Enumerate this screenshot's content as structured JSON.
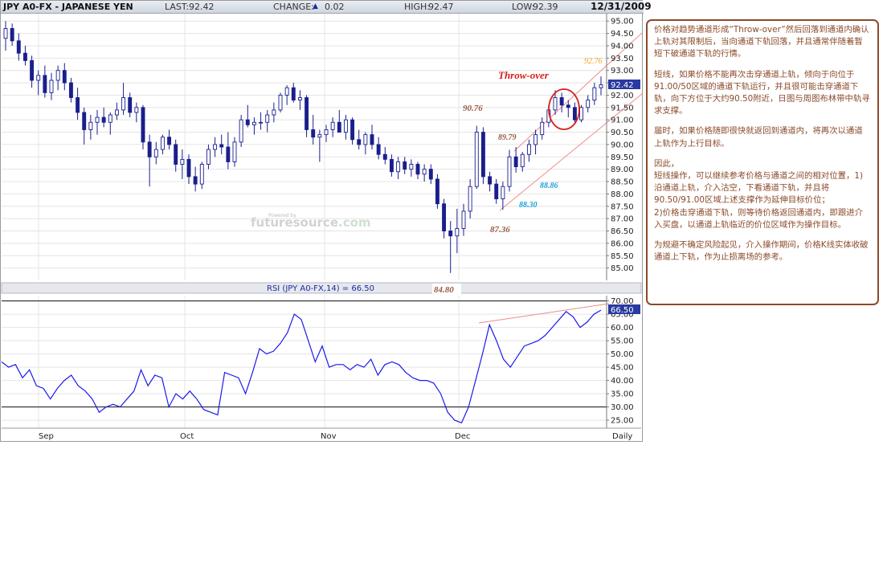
{
  "header": {
    "symbol": "JPY A0-FX - JAPANESE YEN",
    "last_label": "LAST:",
    "last_value": "92.42",
    "change_label": "CHANGE:",
    "change_arrow": "▲",
    "change_value": "0.02",
    "high_label": "HIGH:",
    "high_value": "92.47",
    "low_label": "LOW:",
    "low_value": "92.39",
    "date": "12/31/2009"
  },
  "watermark": {
    "small": "Powered by",
    "brand": "futuresource",
    "suffix": ".com"
  },
  "colors": {
    "up_candle": "#ffffff",
    "down_candle": "#1a1f8c",
    "rsi_line": "#1a1aee",
    "channel": "#f08a8a",
    "annot_brown": "#9a5a42",
    "annot_orange": "#f0a020",
    "annot_cyan": "#1aa0d8",
    "throw_over": "#d81e1e"
  },
  "annotations": {
    "throw_over": "Throw-over",
    "p9276": "92.76",
    "p9076": "90.76",
    "p8979": "89.79",
    "p8886": "88.86",
    "p8830": "88.30",
    "p8736": "87.36",
    "p8480": "84.80"
  },
  "rsi_label": "RSI (JPY A0-FX,14) = 66.50",
  "notes": [
    "价格对趋势通道形成“Throw-over”然后回落到通道内确认上轨对其限制后，当向通道下轨回落，并且通常伴随着暂短下破通道下轨的行情。",
    "短线，如果价格不能再次击穿通道上轨，倾向于向位于91.00/50区域的通道下轨运行，并且很可能击穿通道下轨，向下方位于大约90.50附近，日图与周图布林带中轨寻求支撑。",
    "届时，如果价格随即很快就返回到通道内，将再次以通道上轨作为上行目标。",
    "因此，\n短线操作，可以继续参考价格与通道之间的相对位置，1) 沿通道上轨，介入沽空，下看通道下轨，并且将90.50/91.00区域上述支撑作为延伸目标价位；\n2)价格击穿通道下轨，则等待价格返回通道内，即跟进介入买盘，以通道上轨临近的价位区域作为操作目标。",
    "为规避不确定风险起见，介入操作期间，价格K线实体收破通道上下轨，作为止损离场的参考。"
  ],
  "chart_data": [
    {
      "type": "candlestick",
      "title": "JPY A0-FX - JAPANESE YEN",
      "ylim": [
        84.5,
        95.3
      ],
      "y_ticks": [
        "95.00",
        "94.50",
        "94.00",
        "93.50",
        "93.00",
        "92.50",
        "92.00",
        "91.50",
        "91.00",
        "90.50",
        "90.00",
        "89.50",
        "89.00",
        "88.50",
        "88.00",
        "87.50",
        "87.00",
        "86.50",
        "86.00",
        "85.50",
        "85.00"
      ],
      "x_ticks": [
        "Sep",
        "Oct",
        "Nov",
        "Dec",
        "Daily"
      ],
      "last_price": "92.42",
      "grid": true,
      "candles": [
        {
          "o": 94.3,
          "h": 95.0,
          "l": 93.8,
          "c": 94.7
        },
        {
          "o": 94.7,
          "h": 94.9,
          "l": 94.0,
          "c": 94.2
        },
        {
          "o": 94.2,
          "h": 94.5,
          "l": 93.4,
          "c": 93.7
        },
        {
          "o": 93.7,
          "h": 94.0,
          "l": 93.2,
          "c": 93.4
        },
        {
          "o": 93.4,
          "h": 93.6,
          "l": 92.3,
          "c": 92.6
        },
        {
          "o": 92.6,
          "h": 93.0,
          "l": 92.0,
          "c": 92.8
        },
        {
          "o": 92.8,
          "h": 93.2,
          "l": 91.9,
          "c": 92.1
        },
        {
          "o": 92.1,
          "h": 92.9,
          "l": 91.8,
          "c": 92.6
        },
        {
          "o": 92.6,
          "h": 93.2,
          "l": 92.2,
          "c": 93.0
        },
        {
          "o": 93.0,
          "h": 93.3,
          "l": 92.2,
          "c": 92.5
        },
        {
          "o": 92.5,
          "h": 92.7,
          "l": 91.7,
          "c": 91.9
        },
        {
          "o": 91.9,
          "h": 92.3,
          "l": 91.0,
          "c": 91.3
        },
        {
          "o": 91.3,
          "h": 91.5,
          "l": 90.0,
          "c": 90.6
        },
        {
          "o": 90.6,
          "h": 91.2,
          "l": 90.2,
          "c": 90.9
        },
        {
          "o": 90.9,
          "h": 91.4,
          "l": 90.4,
          "c": 91.1
        },
        {
          "o": 91.1,
          "h": 91.5,
          "l": 90.7,
          "c": 90.9
        },
        {
          "o": 90.9,
          "h": 91.3,
          "l": 90.4,
          "c": 91.2
        },
        {
          "o": 91.2,
          "h": 91.7,
          "l": 91.0,
          "c": 91.4
        },
        {
          "o": 91.4,
          "h": 92.5,
          "l": 91.2,
          "c": 91.9
        },
        {
          "o": 91.9,
          "h": 92.1,
          "l": 91.1,
          "c": 91.3
        },
        {
          "o": 91.3,
          "h": 91.7,
          "l": 90.9,
          "c": 91.5
        },
        {
          "o": 91.5,
          "h": 91.6,
          "l": 89.8,
          "c": 90.1
        },
        {
          "o": 90.1,
          "h": 90.4,
          "l": 88.3,
          "c": 89.5
        },
        {
          "o": 89.5,
          "h": 90.1,
          "l": 89.2,
          "c": 89.8
        },
        {
          "o": 89.8,
          "h": 90.4,
          "l": 89.6,
          "c": 90.3
        },
        {
          "o": 90.3,
          "h": 90.6,
          "l": 89.8,
          "c": 90.0
        },
        {
          "o": 90.0,
          "h": 90.2,
          "l": 88.9,
          "c": 89.2
        },
        {
          "o": 89.2,
          "h": 89.8,
          "l": 88.6,
          "c": 89.4
        },
        {
          "o": 89.4,
          "h": 89.6,
          "l": 88.4,
          "c": 88.7
        },
        {
          "o": 88.7,
          "h": 89.1,
          "l": 88.1,
          "c": 88.4
        },
        {
          "o": 88.4,
          "h": 89.3,
          "l": 88.2,
          "c": 89.2
        },
        {
          "o": 89.2,
          "h": 90.0,
          "l": 89.0,
          "c": 89.8
        },
        {
          "o": 89.8,
          "h": 90.3,
          "l": 89.5,
          "c": 90.0
        },
        {
          "o": 90.0,
          "h": 90.4,
          "l": 89.6,
          "c": 89.9
        },
        {
          "o": 89.9,
          "h": 90.5,
          "l": 89.0,
          "c": 89.3
        },
        {
          "o": 89.3,
          "h": 90.3,
          "l": 89.1,
          "c": 90.1
        },
        {
          "o": 90.1,
          "h": 91.2,
          "l": 89.9,
          "c": 91.0
        },
        {
          "o": 91.0,
          "h": 91.6,
          "l": 90.7,
          "c": 90.8
        },
        {
          "o": 90.8,
          "h": 91.1,
          "l": 90.4,
          "c": 90.9
        },
        {
          "o": 90.9,
          "h": 91.3,
          "l": 90.6,
          "c": 90.9
        },
        {
          "o": 90.9,
          "h": 91.4,
          "l": 90.5,
          "c": 91.2
        },
        {
          "o": 91.2,
          "h": 91.7,
          "l": 90.9,
          "c": 91.4
        },
        {
          "o": 91.4,
          "h": 92.1,
          "l": 91.3,
          "c": 92.0
        },
        {
          "o": 92.0,
          "h": 92.4,
          "l": 91.6,
          "c": 92.3
        },
        {
          "o": 92.3,
          "h": 92.5,
          "l": 91.7,
          "c": 91.8
        },
        {
          "o": 91.8,
          "h": 92.2,
          "l": 91.4,
          "c": 91.9
        },
        {
          "o": 91.9,
          "h": 92.0,
          "l": 90.3,
          "c": 90.6
        },
        {
          "o": 90.6,
          "h": 91.2,
          "l": 90.0,
          "c": 90.3
        },
        {
          "o": 90.3,
          "h": 90.6,
          "l": 89.3,
          "c": 90.4
        },
        {
          "o": 90.4,
          "h": 90.8,
          "l": 90.1,
          "c": 90.6
        },
        {
          "o": 90.6,
          "h": 91.1,
          "l": 90.3,
          "c": 90.9
        },
        {
          "o": 90.9,
          "h": 91.4,
          "l": 90.6,
          "c": 90.5
        },
        {
          "o": 90.5,
          "h": 91.2,
          "l": 90.2,
          "c": 91.0
        },
        {
          "o": 91.0,
          "h": 91.1,
          "l": 90.0,
          "c": 90.2
        },
        {
          "o": 90.2,
          "h": 90.6,
          "l": 89.8,
          "c": 90.0
        },
        {
          "o": 90.0,
          "h": 90.5,
          "l": 89.6,
          "c": 90.4
        },
        {
          "o": 90.4,
          "h": 90.8,
          "l": 89.8,
          "c": 90.0
        },
        {
          "o": 90.0,
          "h": 90.3,
          "l": 89.4,
          "c": 89.6
        },
        {
          "o": 89.6,
          "h": 89.9,
          "l": 89.2,
          "c": 89.4
        },
        {
          "o": 89.4,
          "h": 89.6,
          "l": 88.7,
          "c": 88.9
        },
        {
          "o": 88.9,
          "h": 89.5,
          "l": 88.6,
          "c": 89.3
        },
        {
          "o": 89.3,
          "h": 89.5,
          "l": 88.8,
          "c": 89.0
        },
        {
          "o": 89.0,
          "h": 89.4,
          "l": 88.7,
          "c": 89.2
        },
        {
          "o": 89.2,
          "h": 89.3,
          "l": 88.6,
          "c": 88.8
        },
        {
          "o": 88.8,
          "h": 89.2,
          "l": 88.5,
          "c": 89.0
        },
        {
          "o": 89.0,
          "h": 89.2,
          "l": 88.4,
          "c": 88.6
        },
        {
          "o": 88.6,
          "h": 88.8,
          "l": 87.4,
          "c": 87.6
        },
        {
          "o": 87.6,
          "h": 87.8,
          "l": 86.2,
          "c": 86.5
        },
        {
          "o": 86.5,
          "h": 86.9,
          "l": 84.8,
          "c": 86.3
        },
        {
          "o": 86.3,
          "h": 87.4,
          "l": 85.6,
          "c": 86.6
        },
        {
          "o": 86.6,
          "h": 87.6,
          "l": 86.3,
          "c": 87.3
        },
        {
          "o": 87.3,
          "h": 88.6,
          "l": 87.0,
          "c": 88.3
        },
        {
          "o": 88.3,
          "h": 90.76,
          "l": 88.2,
          "c": 90.5
        },
        {
          "o": 90.5,
          "h": 90.7,
          "l": 88.4,
          "c": 88.7
        },
        {
          "o": 88.7,
          "h": 88.9,
          "l": 88.1,
          "c": 88.4
        },
        {
          "o": 88.4,
          "h": 88.6,
          "l": 87.6,
          "c": 87.8
        },
        {
          "o": 87.8,
          "h": 88.5,
          "l": 87.36,
          "c": 88.3
        },
        {
          "o": 88.3,
          "h": 89.79,
          "l": 88.1,
          "c": 89.5
        },
        {
          "o": 89.5,
          "h": 89.9,
          "l": 88.86,
          "c": 89.1
        },
        {
          "o": 89.1,
          "h": 89.7,
          "l": 88.9,
          "c": 89.6
        },
        {
          "o": 89.6,
          "h": 90.2,
          "l": 89.3,
          "c": 90.0
        },
        {
          "o": 90.0,
          "h": 90.6,
          "l": 89.6,
          "c": 90.4
        },
        {
          "o": 90.4,
          "h": 91.1,
          "l": 90.2,
          "c": 90.9
        },
        {
          "o": 90.9,
          "h": 91.6,
          "l": 90.7,
          "c": 91.4
        },
        {
          "o": 91.4,
          "h": 92.2,
          "l": 91.2,
          "c": 91.9
        },
        {
          "o": 91.9,
          "h": 92.1,
          "l": 91.3,
          "c": 91.6
        },
        {
          "o": 91.6,
          "h": 91.8,
          "l": 91.1,
          "c": 91.5
        },
        {
          "o": 91.5,
          "h": 91.7,
          "l": 90.9,
          "c": 91.0
        },
        {
          "o": 91.0,
          "h": 91.6,
          "l": 90.9,
          "c": 91.5
        },
        {
          "o": 91.5,
          "h": 92.0,
          "l": 91.3,
          "c": 91.8
        },
        {
          "o": 91.8,
          "h": 92.5,
          "l": 91.6,
          "c": 92.3
        },
        {
          "o": 92.3,
          "h": 92.76,
          "l": 92.0,
          "c": 92.42
        }
      ]
    },
    {
      "type": "line",
      "title": "RSI (JPY A0-FX,14) = 66.50",
      "ylim": [
        22,
        72
      ],
      "y_ticks": [
        "70.00",
        "65.00",
        "60.00",
        "55.00",
        "50.00",
        "45.00",
        "40.00",
        "35.00",
        "30.00",
        "25.00"
      ],
      "reference_lines": [
        70,
        30
      ],
      "last_value": "66.50",
      "series": [
        {
          "values": [
            47,
            45,
            46,
            41,
            44,
            38,
            37,
            33,
            37,
            40,
            42,
            38,
            36,
            33,
            28,
            30,
            31,
            30,
            33,
            36,
            44,
            38,
            42,
            41,
            30,
            35,
            33,
            36,
            33,
            29,
            28,
            27,
            43,
            42,
            41,
            35,
            43,
            52,
            50,
            51,
            54,
            58,
            65,
            63,
            55,
            47,
            53,
            45,
            46,
            46,
            44,
            46,
            45,
            48,
            42,
            46,
            47,
            46,
            43,
            41,
            40,
            40,
            39,
            35,
            28,
            25,
            24,
            30,
            40,
            50,
            61,
            55,
            48,
            45,
            49,
            53,
            54,
            55,
            57,
            60,
            63,
            66,
            64,
            60,
            62,
            65,
            66.5
          ]
        }
      ]
    }
  ]
}
